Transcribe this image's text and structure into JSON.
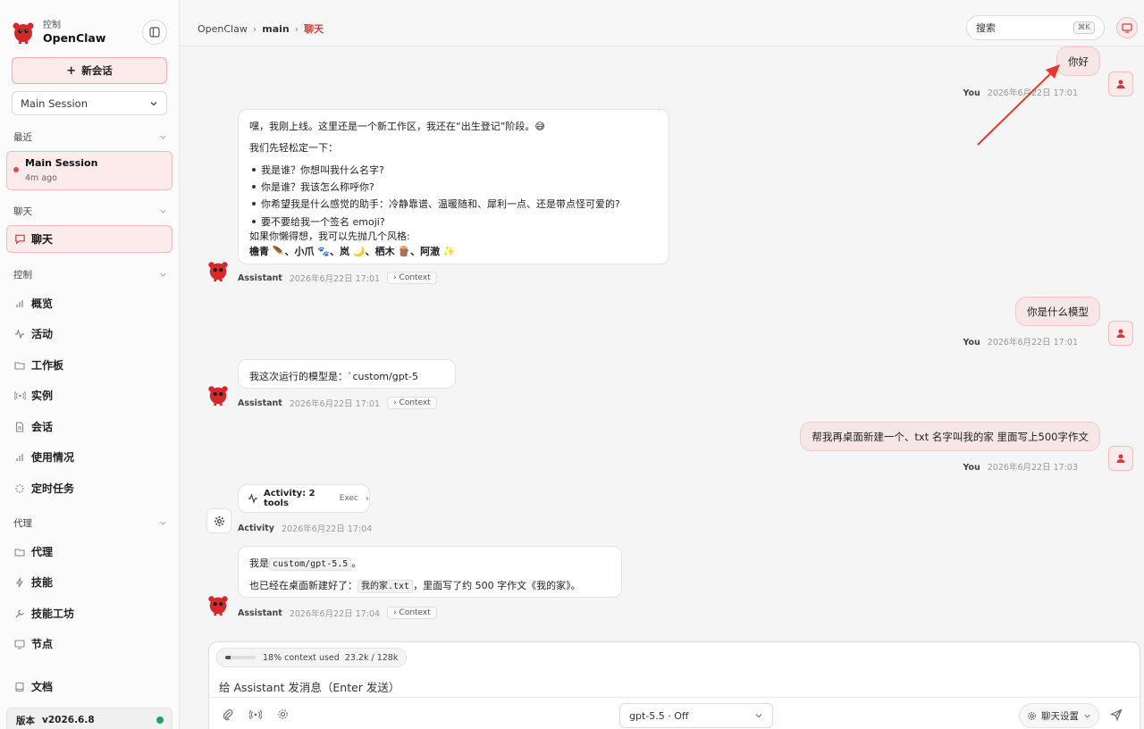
{
  "sidebar": {
    "brand_sub": "控制",
    "brand_name": "OpenClaw",
    "new_chat_label": "新会话",
    "session_select": "Main Session",
    "recent_header": "最近",
    "recent_item": {
      "title": "Main Session",
      "time": "4m ago"
    },
    "chat_header": "聊天",
    "chat_item": "聊天",
    "control_header": "控制",
    "control_items": [
      "概览",
      "活动",
      "工作板",
      "实例",
      "会话",
      "使用情况",
      "定时任务"
    ],
    "agent_header": "代理",
    "agent_items": [
      "代理",
      "技能",
      "技能工坊",
      "节点"
    ],
    "docs": "文档",
    "version_label": "版本",
    "version_value": "v2026.6.8"
  },
  "topbar": {
    "breadcrumb": [
      "OpenClaw",
      "main",
      "聊天"
    ],
    "search_placeholder": "搜索",
    "search_shortcut": "⌘K"
  },
  "chat": {
    "messages": [
      {
        "role": "user",
        "text": "你好",
        "who": "You",
        "time": "2026年6月22日 17:01"
      },
      {
        "role": "assistant",
        "who": "Assistant",
        "time": "2026年6月22日 17:01",
        "context": "Context",
        "lines": [
          "嘿，我刚上线。这里还是一个新工作区，我还在“出生登记”阶段。😅",
          "我们先轻松定一下：",
          "我是谁？你想叫我什么名字?",
          "你是谁？我该怎么称呼你?",
          "你希望我是什么感觉的助手：冷静靠谱、温暖随和、犀利一点、还是带点怪可爱的?",
          "要不要给我一个签名 emoji?",
          "如果你懒得想，我可以先抛几个风格:",
          "檐青 🪶、小爪 🐾、岚 🌙、栖木 🪵、阿澈 ✨"
        ]
      },
      {
        "role": "user",
        "text": "你是什么模型",
        "who": "You",
        "time": "2026年6月22日 17:01"
      },
      {
        "role": "assistant",
        "who": "Assistant",
        "time": "2026年6月22日 17:01",
        "context": "Context",
        "lines": [
          "我这次运行的模型是：`custom/gpt-5"
        ]
      },
      {
        "role": "user",
        "text": "帮我再桌面新建一个、txt 名字叫我的家 里面写上500字作文",
        "who": "You",
        "time": "2026年6月22日 17:03"
      },
      {
        "role": "activity",
        "title": "Activity: 2 tools",
        "tag": "Exec",
        "who": "Activity",
        "time": "2026年6月22日 17:04"
      },
      {
        "role": "assistant",
        "who": "Assistant",
        "time": "2026年6月22日 17:04",
        "context": "Context",
        "l1_a": "我是",
        "l1_code": "custom/gpt-5.5",
        "l1_b": "。",
        "l2_a": "也已经在桌面新建好了：",
        "l2_code": "我的家.txt",
        "l2_b": "，里面写了约 500 字作文《我的家》。"
      }
    ]
  },
  "composer": {
    "context_used": 0.18,
    "context_label": "18% context used",
    "tokens": "23.2k / 128k",
    "placeholder": "给 Assistant 发消息（Enter 发送）",
    "model": "gpt-5.5 · Off",
    "settings_label": "聊天设置"
  },
  "colors": {
    "accent": "#d23b3b",
    "accent_bg": "#fdeaea",
    "online": "#22a559"
  }
}
